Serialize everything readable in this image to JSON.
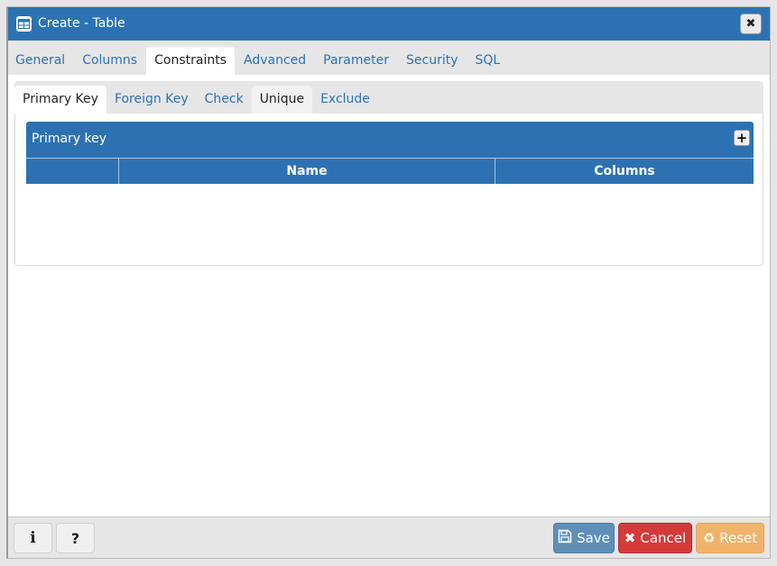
{
  "window": {
    "title": "Create - Table",
    "title_icon": "table-icon",
    "close_icon": "close-icon",
    "close_glyph": "✖"
  },
  "tabs": [
    {
      "label": "General",
      "active": false
    },
    {
      "label": "Columns",
      "active": false
    },
    {
      "label": "Constraints",
      "active": true
    },
    {
      "label": "Advanced",
      "active": false
    },
    {
      "label": "Parameter",
      "active": false
    },
    {
      "label": "Security",
      "active": false
    },
    {
      "label": "SQL",
      "active": false
    }
  ],
  "subtabs": [
    {
      "label": "Primary Key",
      "active": true
    },
    {
      "label": "Foreign Key",
      "active": false
    },
    {
      "label": "Check",
      "active": false
    },
    {
      "label": "Unique",
      "active": false
    },
    {
      "label": "Exclude",
      "active": false
    }
  ],
  "grid": {
    "title": "Primary key",
    "add_glyph": "+",
    "columns": [
      "",
      "Name",
      "Columns"
    ],
    "rows": []
  },
  "footer": {
    "info_glyph": "i",
    "help_glyph": "?",
    "save_label": "Save",
    "save_glyph": "🖫",
    "cancel_label": "Cancel",
    "cancel_glyph": "✖",
    "reset_label": "Reset",
    "reset_glyph": "♻"
  },
  "colors": {
    "primary": "#2c72b3",
    "save": "#5f8fb7",
    "cancel": "#d53a3a",
    "reset": "#f0b36b"
  }
}
